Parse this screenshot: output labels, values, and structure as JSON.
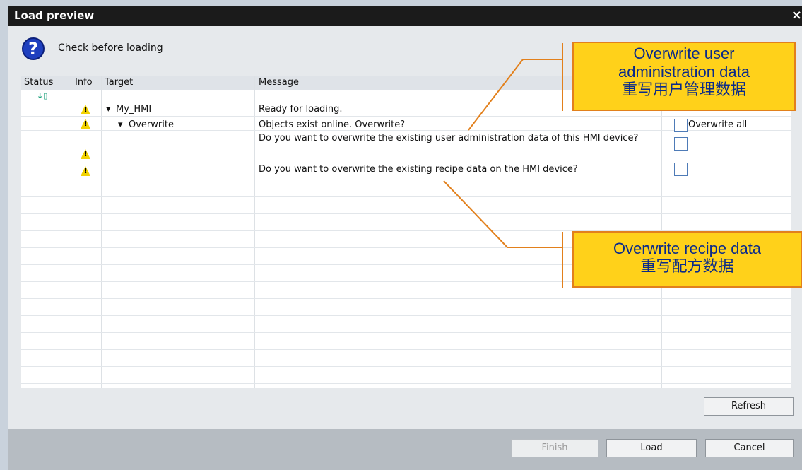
{
  "dialog": {
    "title": "Load preview",
    "close_symbol": "×",
    "question_text": "Check before loading"
  },
  "table": {
    "columns": [
      "Status",
      "Info",
      "Target",
      "Message"
    ],
    "rows": [
      {
        "target": "My_HMI",
        "message": "Ready for loading.",
        "option": ""
      },
      {
        "target": "Overwrite",
        "message": "Objects exist online. Overwrite?",
        "option": "Overwrite all"
      },
      {
        "target": "",
        "message": "Do you want to overwrite the existing user administration data of this HMI device?",
        "option": ""
      },
      {
        "target": "",
        "message": "Do you want to overwrite the existing recipe data on the HMI device?",
        "option": ""
      }
    ]
  },
  "buttons": {
    "refresh": "Refresh",
    "finish": "Finish",
    "load": "Load",
    "cancel": "Cancel"
  },
  "callouts": {
    "user_admin": {
      "line1": "Overwrite user",
      "line2": "administration data",
      "line3": "重写用户管理数据"
    },
    "recipe": {
      "line1": "Overwrite recipe data",
      "line2": "重写配方数据"
    }
  },
  "colors": {
    "callout_fill": "#ffd11a",
    "callout_border": "#e2801c",
    "warning": "#f2d200",
    "title_bar": "#1b1b1b"
  }
}
